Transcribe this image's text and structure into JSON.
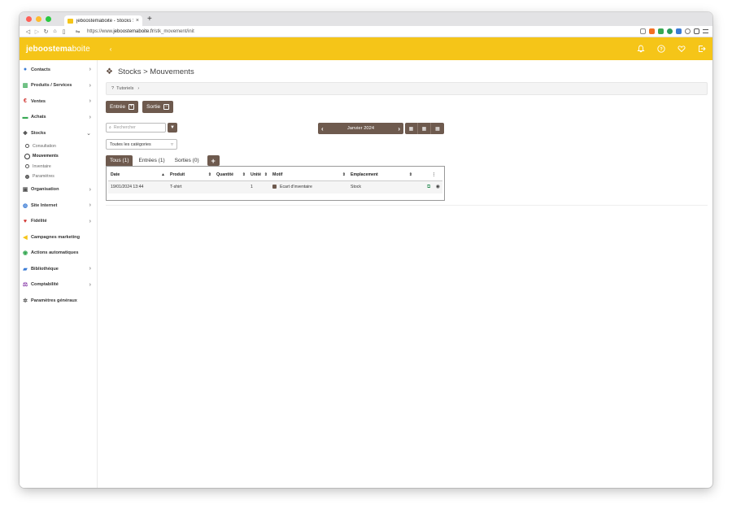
{
  "browser": {
    "tab_title": "jeboostemaboite - Stocks > Mo",
    "tab_close": "×",
    "new_tab": "+",
    "url_prefix": "https://www.",
    "url_host": "jeboostemaboite.fr",
    "url_path": "/stk_movement/init"
  },
  "app": {
    "logo_bold": "jeboostema",
    "logo_thin": "boite",
    "collapse_glyph": "‹"
  },
  "sidebar": {
    "items": [
      {
        "label": "Contacts",
        "icon": "user-icon",
        "color": "#3a7bd5"
      },
      {
        "label": "Produits / Services",
        "icon": "barcode-icon",
        "color": "#36a853"
      },
      {
        "label": "Ventes",
        "icon": "euro-icon",
        "color": "#d0312d"
      },
      {
        "label": "Achats",
        "icon": "cart-icon",
        "color": "#36a853"
      },
      {
        "label": "Stocks",
        "icon": "boxes-icon",
        "color": "#555555"
      },
      {
        "label": "Organisation",
        "icon": "checklist-icon",
        "color": "#555555"
      },
      {
        "label": "Site Internet",
        "icon": "globe-icon",
        "color": "#3a7bd5"
      },
      {
        "label": "Fidélité",
        "icon": "heart-icon",
        "color": "#d0312d"
      },
      {
        "label": "Campagnes marketing",
        "icon": "megaphone-icon",
        "color": "#f5c518"
      },
      {
        "label": "Actions automatiques",
        "icon": "bolt-icon",
        "color": "#36a853"
      },
      {
        "label": "Bibliothèque",
        "icon": "folder-icon",
        "color": "#3a7bd5"
      },
      {
        "label": "Comptabilité",
        "icon": "scale-icon",
        "color": "#8e44ad"
      },
      {
        "label": "Paramètres généraux",
        "icon": "gear-icon",
        "color": "#555555"
      }
    ],
    "stocks_sub": [
      {
        "label": "Consultation"
      },
      {
        "label": "Mouvements"
      },
      {
        "label": "Inventaire"
      },
      {
        "label": "Paramètres"
      }
    ]
  },
  "page": {
    "title": "Stocks > Mouvements",
    "tutorials": "Tutoriels",
    "entree_label": "Entrée",
    "sortie_label": "Sortie",
    "search_placeholder": "Rechercher",
    "month_label": "Janvier 2024",
    "category_select": "Toutes les catégories",
    "tabs": [
      "Tous (1)",
      "Entrées (1)",
      "Sorties (0)"
    ],
    "add_tab": "+"
  },
  "table": {
    "headers": [
      "Date",
      "Produit",
      "Quantité",
      "Unité",
      "Motif",
      "Emplacement"
    ],
    "rows": [
      {
        "date": "19/01/2024 13:44",
        "produit": "T-shirt",
        "quantite": "",
        "unite": "1",
        "motif": "Ecart d'inventaire",
        "emplacement": "Stock"
      }
    ]
  },
  "colors": {
    "brand_yellow": "#f5c518",
    "brand_brown": "#6e5a4e"
  }
}
